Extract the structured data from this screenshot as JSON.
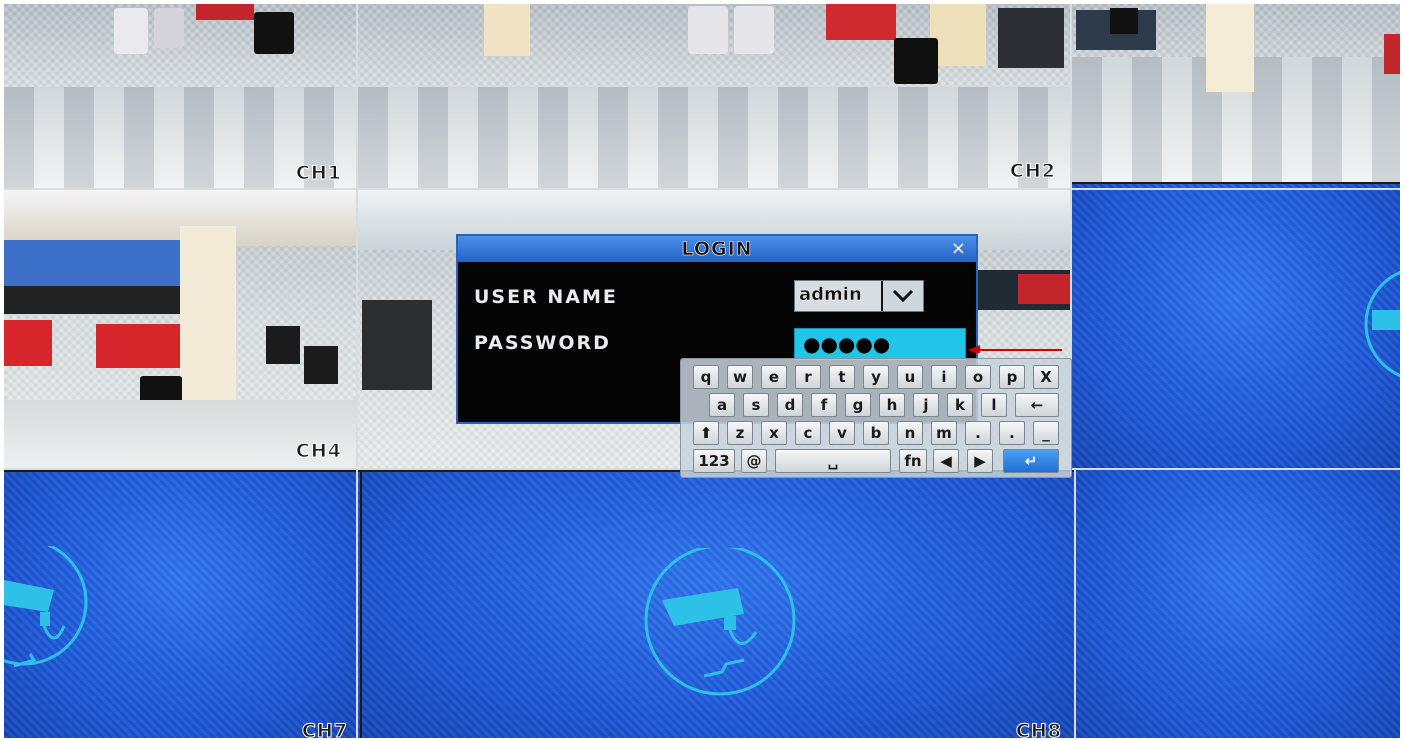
{
  "channels": {
    "ch1": "CH1",
    "ch2": "CH2",
    "ch4": "CH4",
    "ch7": "CH7",
    "ch8": "CH8"
  },
  "login": {
    "title": "LOGIN",
    "close": "×",
    "username_label": "USER NAME",
    "username_value": "admin",
    "password_label": "PASSWORD",
    "password_value": "●●●●●"
  },
  "keyboard": {
    "row1": [
      "q",
      "w",
      "e",
      "r",
      "t",
      "y",
      "u",
      "i",
      "o",
      "p",
      "X"
    ],
    "row2": [
      "a",
      "s",
      "d",
      "f",
      "g",
      "h",
      "j",
      "k",
      "l",
      "←"
    ],
    "row3": [
      "z",
      "x",
      "c",
      "v",
      "b",
      "n",
      "m",
      ".",
      ".",
      "_"
    ],
    "row4": {
      "numbers": "123",
      "at": "@",
      "fn": "fn",
      "left": "◀",
      "right": "▶",
      "enter": "↵",
      "shift": "⬆",
      "space": "␣"
    }
  },
  "colors": {
    "no_signal_blue": "#1d58d9",
    "dialog_title_blue": "#2263c9",
    "password_field": "#20c6ea",
    "annotation_arrow": "#d40000"
  },
  "icons": [
    "camera-icon",
    "chevron-down-icon",
    "close-icon",
    "shift-icon",
    "backspace-icon",
    "enter-icon",
    "arrow-left-icon",
    "arrow-right-icon"
  ]
}
